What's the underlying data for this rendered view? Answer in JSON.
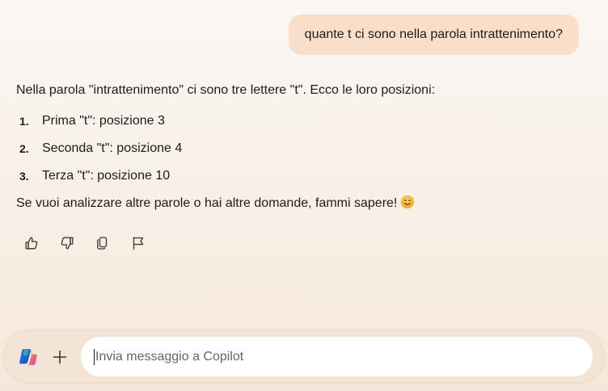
{
  "conversation": {
    "user_message": "quante t ci sono nella parola intrattenimento?",
    "response": {
      "intro": "Nella parola \"intrattenimento\" ci sono tre lettere \"t\". Ecco le loro posizioni:",
      "list": [
        {
          "num": "1.",
          "text": "Prima \"t\": posizione 3"
        },
        {
          "num": "2.",
          "text": "Seconda \"t\": posizione 4"
        },
        {
          "num": "3.",
          "text": "Terza \"t\": posizione 10"
        }
      ],
      "outro": "Se vuoi analizzare altre parole o hai altre domande, fammi sapere!",
      "outro_emoji": "smiling-face-emoji"
    },
    "actions": [
      "thumbs-up-icon",
      "thumbs-down-icon",
      "copy-icon",
      "flag-icon"
    ]
  },
  "composer": {
    "placeholder": "Invia messaggio a Copilot",
    "value": "",
    "logo": "copilot-logo",
    "plus_icon": "plus-icon"
  },
  "colors": {
    "user_bubble": "#f9dfca",
    "composer_bg": "#f4e4d6",
    "input_bg": "#ffffff",
    "text": "#1f1b18"
  }
}
